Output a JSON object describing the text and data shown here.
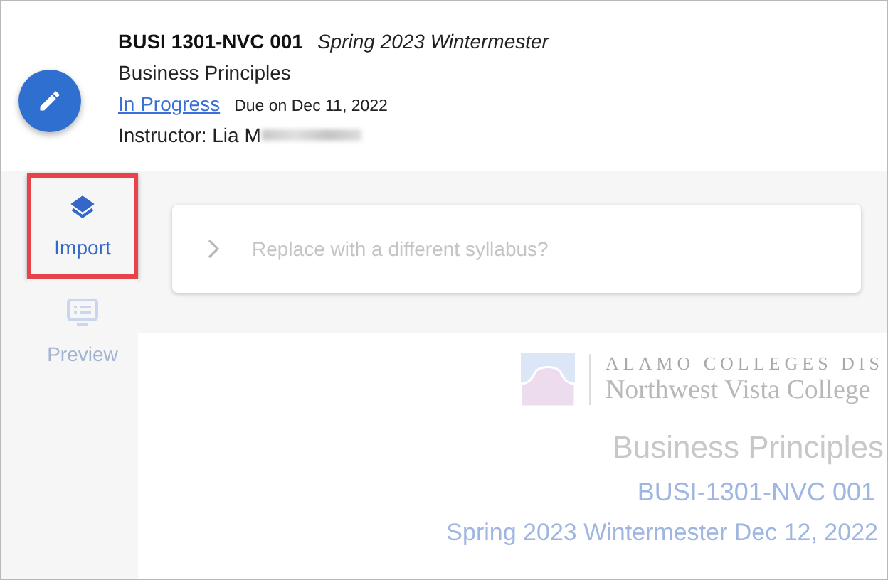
{
  "course": {
    "code": "BUSI 1301-NVC 001",
    "term": "Spring 2023 Wintermester",
    "name": "Business Principles",
    "status": "In Progress",
    "due": "Due on Dec 11, 2022",
    "instructor": "Instructor: Lia M"
  },
  "nav": [
    {
      "label": "Import",
      "selected": true,
      "highlighted": true,
      "disabled": false
    },
    {
      "label": "Preview",
      "selected": false,
      "highlighted": false,
      "disabled": true
    }
  ],
  "replace_panel": {
    "label": "Replace with a different syllabus?",
    "expanded": false
  },
  "document": {
    "logo_top": "ALAMO COLLEGES DIS",
    "logo_bottom": "Northwest Vista College",
    "title": "Business Principles",
    "section": "BUSI-1301-NVC 001",
    "term_line": "Spring 2023 Wintermester Dec 12, 2022"
  }
}
